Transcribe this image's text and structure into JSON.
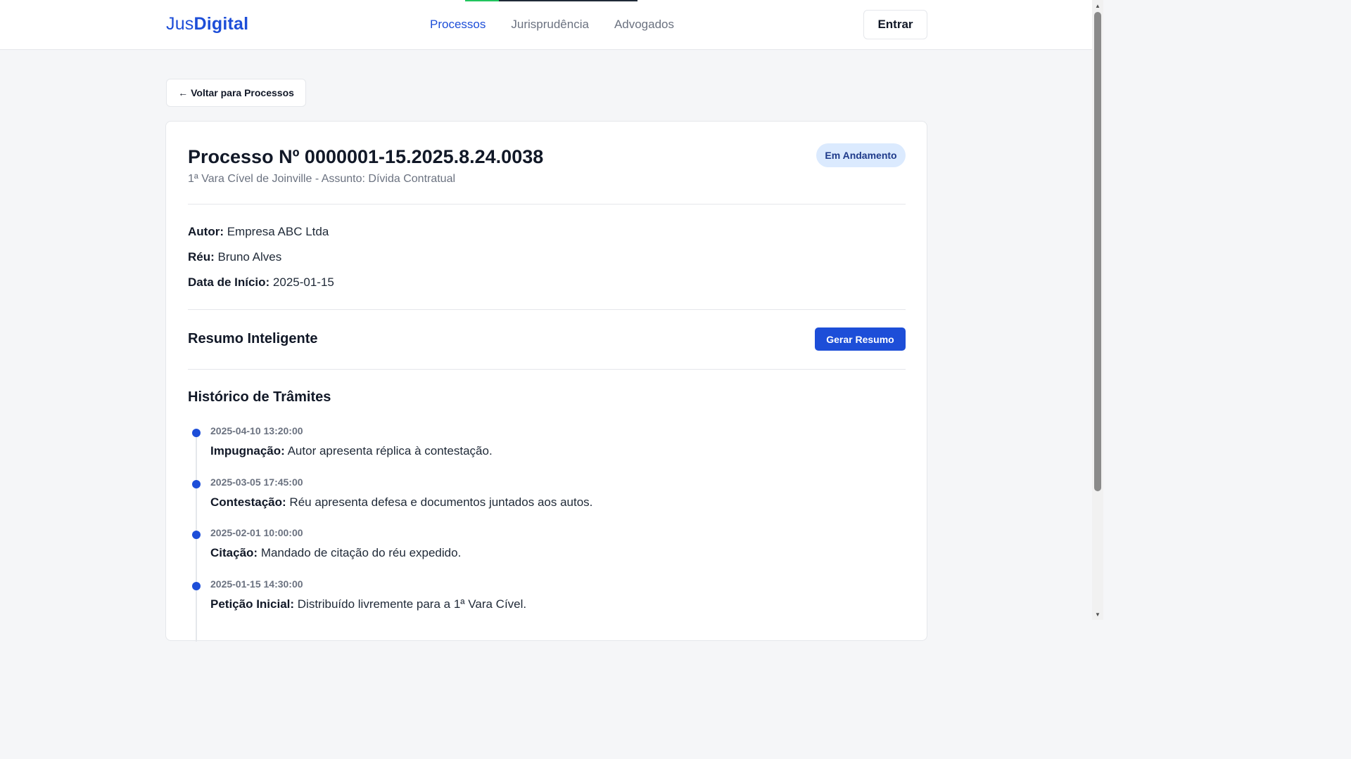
{
  "header": {
    "logo_prefix": "Jus",
    "logo_suffix": "Digital",
    "nav": [
      {
        "label": "Processos",
        "active": true
      },
      {
        "label": "Jurisprudência",
        "active": false
      },
      {
        "label": "Advogados",
        "active": false
      }
    ],
    "login_label": "Entrar"
  },
  "back": {
    "arrow": "←",
    "label": "Voltar para Processos"
  },
  "process": {
    "title": "Processo Nº 0000001-15.2025.8.24.0038",
    "subtitle": "1ª Vara Cível de Joinville - Assunto: Dívida Contratual",
    "status": "Em Andamento",
    "fields": [
      {
        "label": "Autor:",
        "value": "Empresa ABC Ltda"
      },
      {
        "label": "Réu:",
        "value": "Bruno Alves"
      },
      {
        "label": "Data de Início:",
        "value": "2025-01-15"
      }
    ]
  },
  "summary": {
    "title": "Resumo Inteligente",
    "button_label": "Gerar Resumo"
  },
  "history": {
    "title": "Histórico de Trâmites",
    "items": [
      {
        "date": "2025-04-10 13:20:00",
        "type": "Impugnação:",
        "text": "Autor apresenta réplica à contestação."
      },
      {
        "date": "2025-03-05 17:45:00",
        "type": "Contestação:",
        "text": "Réu apresenta defesa e documentos juntados aos autos."
      },
      {
        "date": "2025-02-01 10:00:00",
        "type": "Citação:",
        "text": "Mandado de citação do réu expedido."
      },
      {
        "date": "2025-01-15 14:30:00",
        "type": "Petição Inicial:",
        "text": "Distribuído livremente para a 1ª Vara Cível."
      }
    ]
  },
  "colors": {
    "accent": "#1d4ed8",
    "badge_bg": "#dbeafe",
    "page_bg": "#f5f6f8"
  }
}
